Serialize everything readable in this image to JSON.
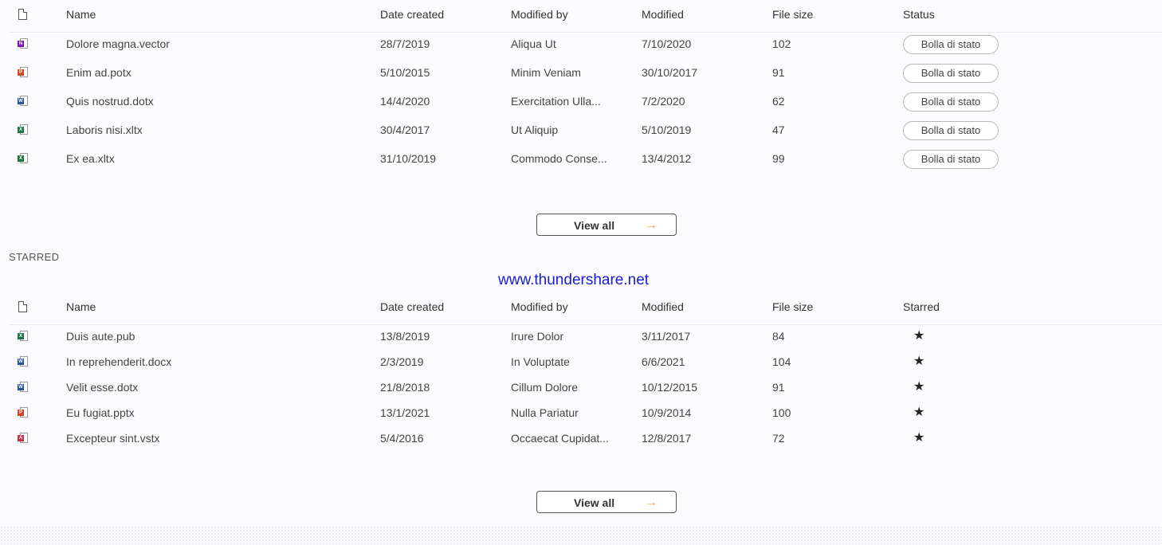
{
  "columns_top": {
    "name": "Name",
    "date_created": "Date created",
    "modified_by": "Modified by",
    "modified": "Modified",
    "file_size": "File size",
    "status": "Status"
  },
  "recent_rows": [
    {
      "icon": "onenote-icon",
      "icon_color": "#7719aa",
      "icon_letter": "N",
      "name": "Dolore magna.vector",
      "date_created": "28/7/2019",
      "modified_by": "Aliqua Ut",
      "modified": "7/10/2020",
      "file_size": "102",
      "status": "Bolla di stato"
    },
    {
      "icon": "powerpoint-icon",
      "icon_color": "#d24726",
      "icon_letter": "P",
      "name": "Enim ad.potx",
      "date_created": "5/10/2015",
      "modified_by": "Minim Veniam",
      "modified": "30/10/2017",
      "file_size": "91",
      "status": "Bolla di stato"
    },
    {
      "icon": "word-icon",
      "icon_color": "#2b579a",
      "icon_letter": "W",
      "name": "Quis nostrud.dotx",
      "date_created": "14/4/2020",
      "modified_by": "Exercitation Ulla...",
      "modified": "7/2/2020",
      "file_size": "62",
      "status": "Bolla di stato"
    },
    {
      "icon": "excel-icon",
      "icon_color": "#217346",
      "icon_letter": "X",
      "name": "Laboris nisi.xltx",
      "date_created": "30/4/2017",
      "modified_by": "Ut Aliquip",
      "modified": "5/10/2019",
      "file_size": "47",
      "status": "Bolla di stato"
    },
    {
      "icon": "excel-icon",
      "icon_color": "#217346",
      "icon_letter": "X",
      "name": "Ex ea.xltx",
      "date_created": "31/10/2019",
      "modified_by": "Commodo Conse...",
      "modified": "13/4/2012",
      "file_size": "99",
      "status": "Bolla di stato"
    }
  ],
  "view_all_label": "View all",
  "arrow_glyph": "→",
  "starred_section_label": "STARRED",
  "watermark": "www.thundershare.net",
  "columns_starred": {
    "name": "Name",
    "date_created": "Date created",
    "modified_by": "Modified by",
    "modified": "Modified",
    "file_size": "File size",
    "starred": "Starred"
  },
  "starred_rows": [
    {
      "icon": "excel-icon",
      "icon_color": "#217346",
      "icon_letter": "X",
      "name": "Duis aute.pub",
      "date_created": "13/8/2019",
      "modified_by": "Irure Dolor",
      "modified": "3/11/2017",
      "file_size": "84",
      "star": "★"
    },
    {
      "icon": "word-icon",
      "icon_color": "#2b579a",
      "icon_letter": "W",
      "name": "In reprehenderit.docx",
      "date_created": "2/3/2019",
      "modified_by": "In Voluptate",
      "modified": "6/6/2021",
      "file_size": "104",
      "star": "★"
    },
    {
      "icon": "word-icon",
      "icon_color": "#2b579a",
      "icon_letter": "W",
      "name": "Velit esse.dotx",
      "date_created": "21/8/2018",
      "modified_by": "Cillum Dolore",
      "modified": "10/12/2015",
      "file_size": "91",
      "star": "★"
    },
    {
      "icon": "powerpoint-icon",
      "icon_color": "#d24726",
      "icon_letter": "P",
      "name": "Eu fugiat.pptx",
      "date_created": "13/1/2021",
      "modified_by": "Nulla Pariatur",
      "modified": "10/9/2014",
      "file_size": "100",
      "star": "★"
    },
    {
      "icon": "acrobat-icon",
      "icon_color": "#c4314b",
      "icon_letter": "A",
      "name": "Excepteur sint.vstx",
      "date_created": "5/4/2016",
      "modified_by": "Occaecat Cupidat...",
      "modified": "12/8/2017",
      "file_size": "72",
      "star": "★"
    }
  ]
}
